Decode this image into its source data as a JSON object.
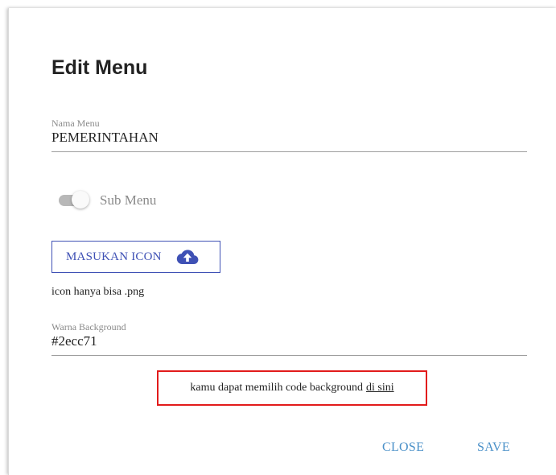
{
  "dialog": {
    "title": "Edit Menu",
    "menu_name": {
      "label": "Nama Menu",
      "value": "PEMERINTAHAN"
    },
    "sub_menu": {
      "label": "Sub Menu",
      "checked": false
    },
    "icon_upload": {
      "label": "MASUKAN ICON",
      "icon": "cloud-upload-icon",
      "hint": "icon hanya bisa .png"
    },
    "background_color": {
      "label": "Warna Background",
      "value": "#2ecc71"
    },
    "notice": {
      "text": "kamu dapat memilih code background",
      "link_text": "di sini"
    },
    "actions": {
      "close_label": "CLOSE",
      "save_label": "SAVE"
    }
  },
  "colors": {
    "primary": "#3f51b5",
    "action_text": "#4a90c8",
    "notice_border": "#e21b1b",
    "switch_track": "#b8b8b8"
  }
}
